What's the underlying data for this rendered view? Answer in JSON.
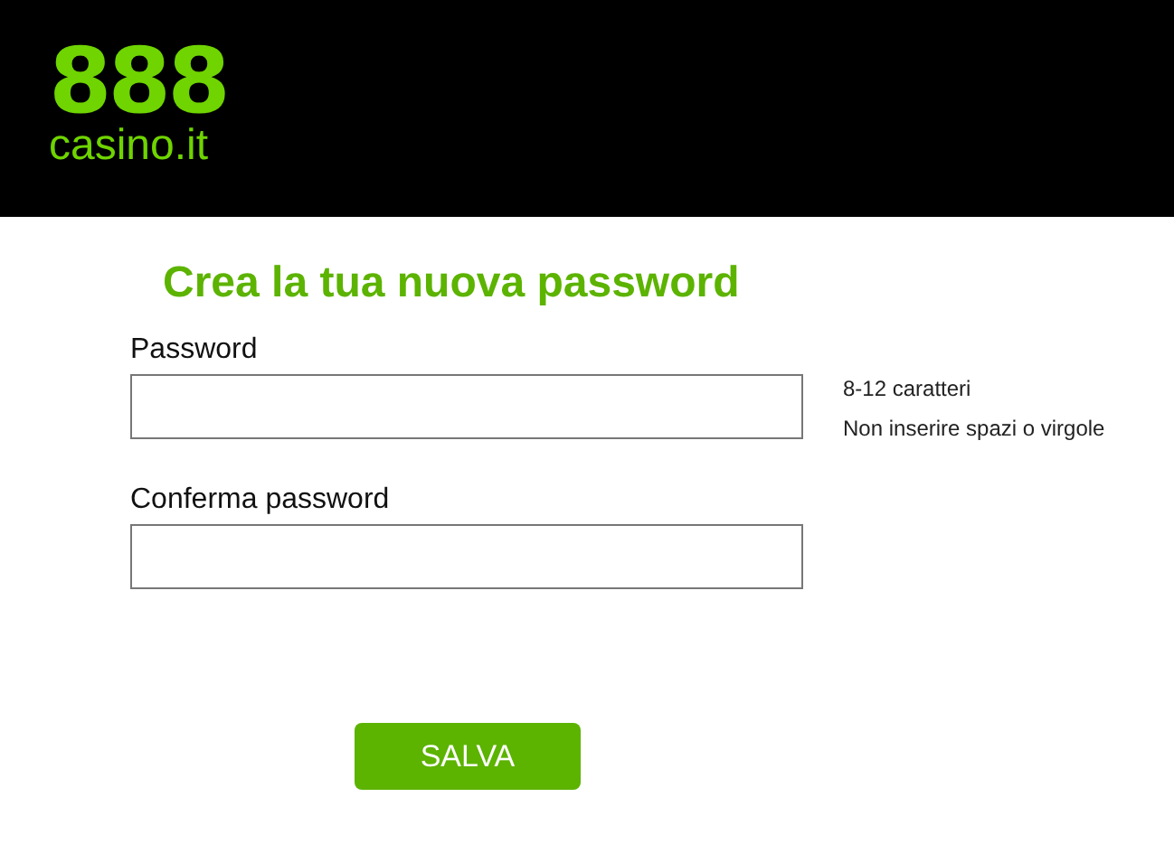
{
  "header": {
    "logo_number": "888",
    "logo_name": "casino.it"
  },
  "title": "Crea la tua nuova password",
  "fields": [
    {
      "label": "Password",
      "hints": [
        "8-12 caratteri",
        "Non inserire spazi o virgole"
      ]
    },
    {
      "label": "Conferma password"
    }
  ],
  "button": "SALVA"
}
